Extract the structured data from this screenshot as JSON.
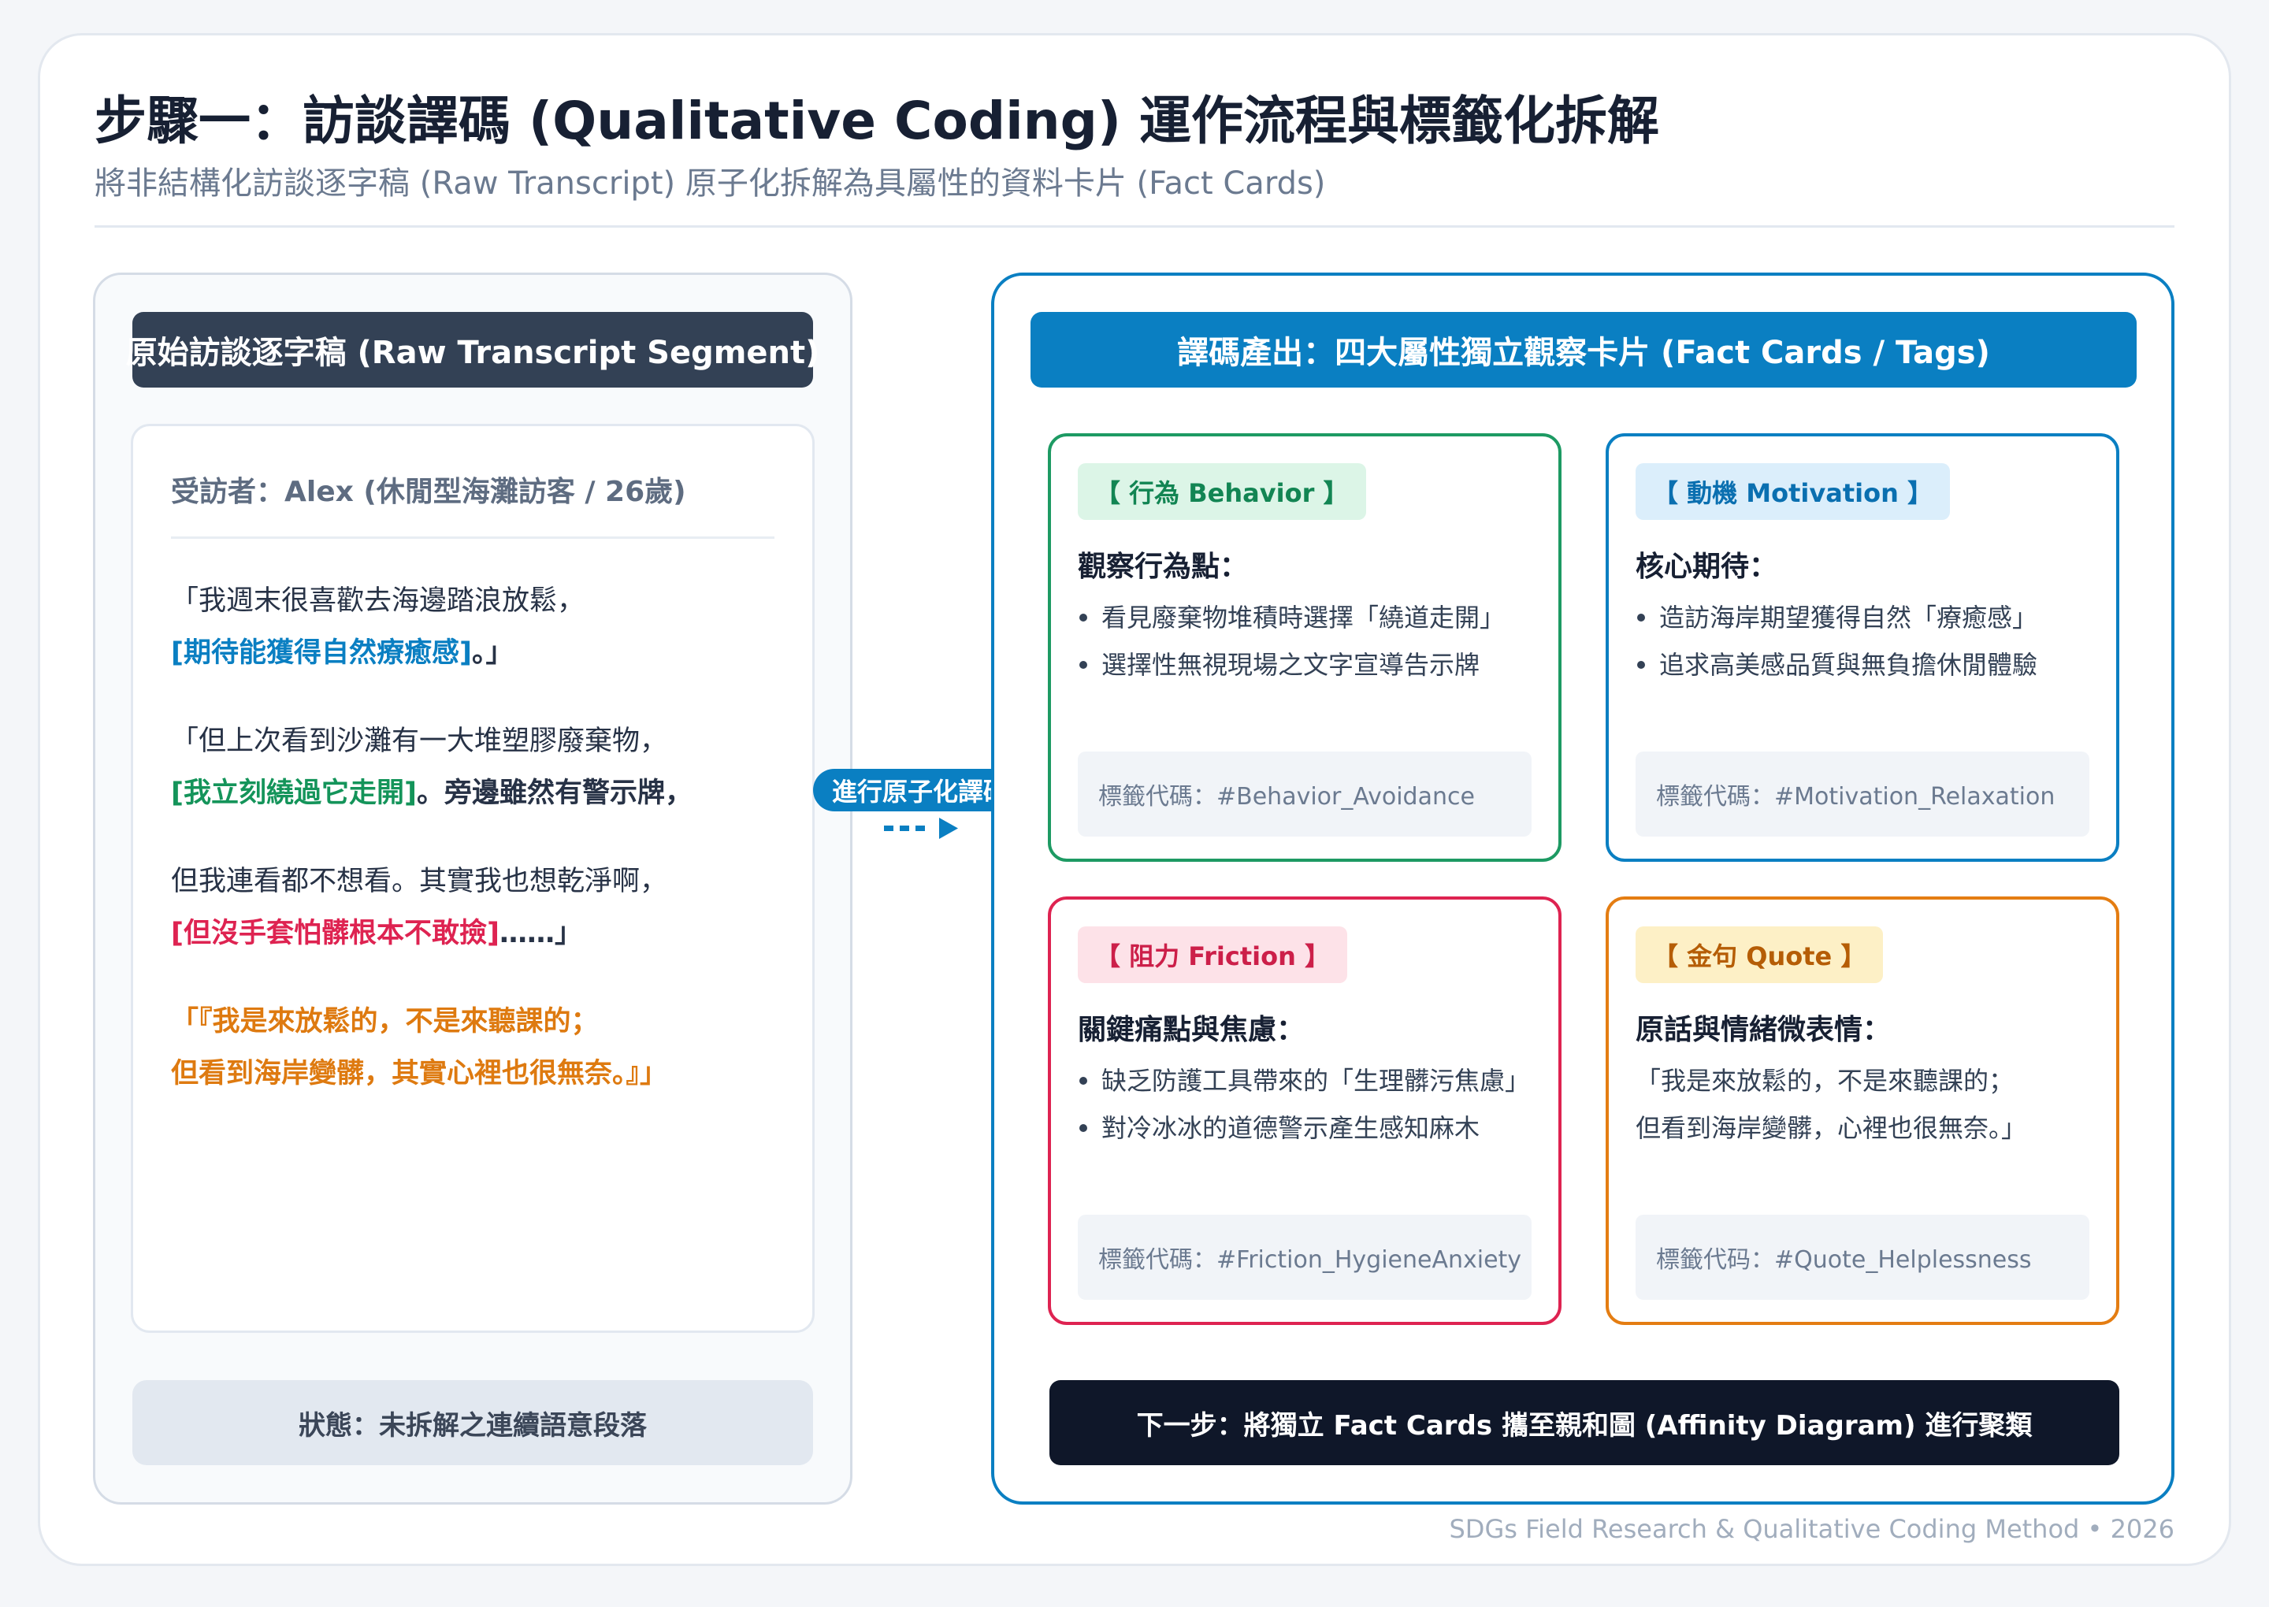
{
  "header": {
    "title": "步驟一：訪談譯碼 (Qualitative Coding) 運作流程與標籤化拆解",
    "subtitle": "將非結構化訪談逐字稿 (Raw Transcript) 原子化拆解為具屬性的資料卡片 (Fact Cards)"
  },
  "left_panel": {
    "header": "原始訪談逐字稿 (Raw Transcript Segment)",
    "interviewee": "受訪者：Alex (休閒型海灘訪客 / 26歲)",
    "p1": {
      "l1": "「我週末很喜歡去海邊踏浪放鬆，",
      "l2_highlight": "[期待能獲得自然療癒感]",
      "l2_end": "。」"
    },
    "p2": {
      "l1": "「但上次看到沙灘有一大堆塑膠廢棄物，",
      "l2_highlight": "[我立刻繞過它走開]",
      "l2_end": "。旁邊雖然有警示牌，"
    },
    "p3": {
      "l1": "但我連看都不想看。其實我也想乾淨啊，",
      "l2_highlight": "[但沒手套怕髒根本不敢撿]",
      "l2_end": "……」"
    },
    "p4": {
      "l1": "「『我是來放鬆的，不是來聽課的；",
      "l2": "但看到海岸變髒，其實心裡也很無奈。』」"
    },
    "status": "狀態：未拆解之連續語意段落"
  },
  "connector": {
    "label": "進行原子化譯碼",
    "icon": "dashed-arrow-right-icon"
  },
  "right_panel": {
    "header": "譯碼產出：四大屬性獨立觀察卡片 (Fact Cards / Tags)",
    "cards": {
      "behavior": {
        "tag": "【 行為 Behavior 】",
        "heading": "觀察行為點：",
        "bullets": [
          "看見廢棄物堆積時選擇「繞道走開」",
          "選擇性無視現場之文字宣導告示牌"
        ],
        "code": "標籤代碼：#Behavior_Avoidance",
        "color": "#1d9a63"
      },
      "motivation": {
        "tag": "【 動機 Motivation 】",
        "heading": "核心期待：",
        "bullets": [
          "造訪海岸期望獲得自然「療癒感」",
          "追求高美感品質與無負擔休閒體驗"
        ],
        "code": "標籤代碼：#Motivation_Relaxation",
        "color": "#0a7fc2"
      },
      "friction": {
        "tag": "【 阻力 Friction 】",
        "heading": "關鍵痛點與焦慮：",
        "bullets": [
          "缺乏防護工具帶來的「生理髒污焦慮」",
          "對冷冰冰的道德警示產生感知麻木"
        ],
        "code": "標籤代碼：#Friction_HygieneAnxiety",
        "color": "#de2351"
      },
      "quote": {
        "tag": "【 金句 Quote 】",
        "heading": "原話與情緒微表情：",
        "lines": [
          "「我是來放鬆的，不是來聽課的；",
          "但看到海岸變髒，心裡也很無奈。」"
        ],
        "code": "標籤代码：#Quote_Helplessness",
        "color": "#e47d12"
      }
    },
    "next_step": "下一步：將獨立 Fact Cards 攜至親和圖 (Affinity Diagram) 進行聚類"
  },
  "footer": "SDGs Field Research & Qualitative Coding Method • 2026"
}
